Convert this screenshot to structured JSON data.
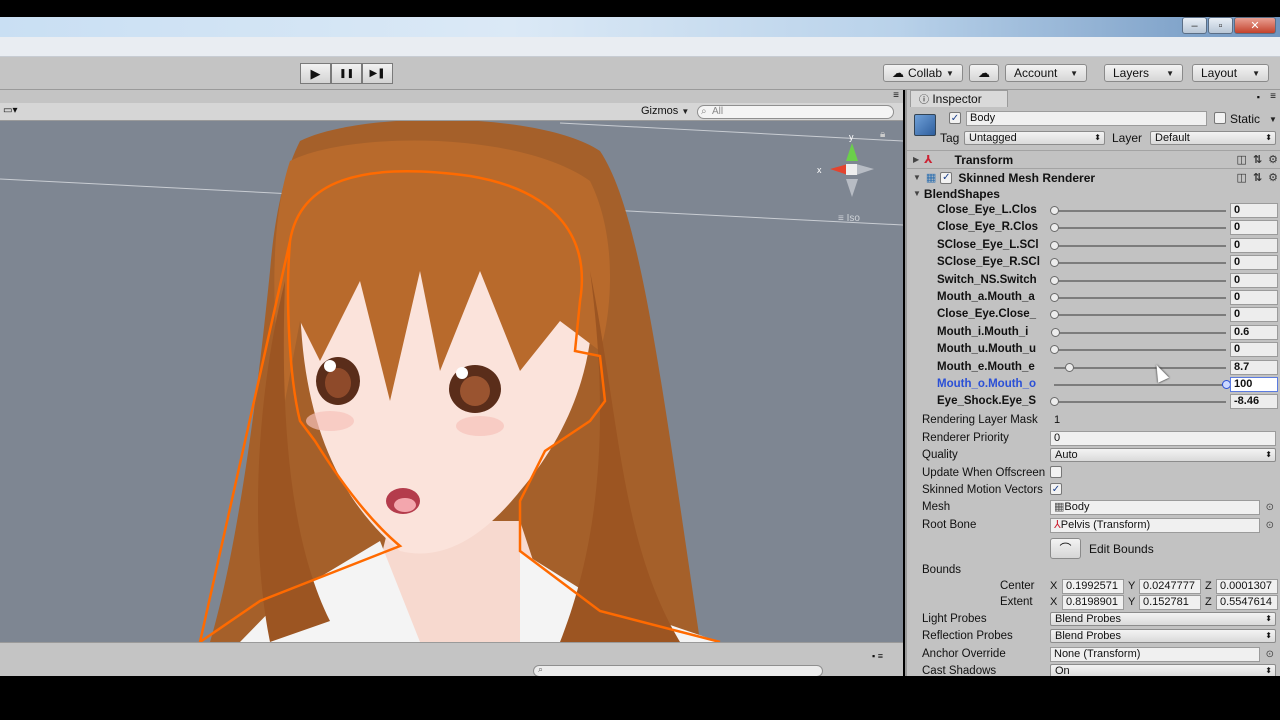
{
  "toolbar": {
    "play_icon": "▶",
    "pause_icon": "❚❚",
    "step_icon": "▶❚",
    "collab": "Collab",
    "account": "Account",
    "layers": "Layers",
    "layout": "Layout"
  },
  "scene": {
    "gizmos": "Gizmos",
    "search_placeholder": "All",
    "axis_y": "y",
    "axis_x": "x",
    "projection": "Iso"
  },
  "inspector": {
    "tab": "Inspector",
    "object_name": "Body",
    "static": "Static",
    "tag_label": "Tag",
    "tag_value": "Untagged",
    "layer_label": "Layer",
    "layer_value": "Default",
    "transform": "Transform",
    "skinned_mesh": "Skinned Mesh Renderer",
    "blendshapes_title": "BlendShapes",
    "blendshapes": [
      {
        "label": "Close_Eye_L.Clos",
        "value": "0",
        "fraction": 0.0
      },
      {
        "label": "Close_Eye_R.Clos",
        "value": "0",
        "fraction": 0.0
      },
      {
        "label": "SClose_Eye_L.SCl",
        "value": "0",
        "fraction": 0.0
      },
      {
        "label": "SClose_Eye_R.SCl",
        "value": "0",
        "fraction": 0.0
      },
      {
        "label": "Switch_NS.Switch",
        "value": "0",
        "fraction": 0.0
      },
      {
        "label": "Mouth_a.Mouth_a",
        "value": "0",
        "fraction": 0.0
      },
      {
        "label": "Close_Eye.Close_",
        "value": "0",
        "fraction": 0.0
      },
      {
        "label": "Mouth_i.Mouth_i",
        "value": "0.6",
        "fraction": 0.006
      },
      {
        "label": "Mouth_u.Mouth_u",
        "value": "0",
        "fraction": 0.0
      },
      {
        "label": "Mouth_e.Mouth_e",
        "value": "8.7",
        "fraction": 0.087
      },
      {
        "label": "Mouth_o.Mouth_o",
        "value": "100",
        "fraction": 1.0
      },
      {
        "label": "Eye_Shock.Eye_S",
        "value": "-8.46",
        "fraction": 0.0
      }
    ],
    "rendering_layer_mask_label": "Rendering Layer Mask",
    "rendering_layer_mask": "1",
    "renderer_priority_label": "Renderer Priority",
    "renderer_priority": "0",
    "quality_label": "Quality",
    "quality": "Auto",
    "update_offscreen_label": "Update When Offscreen",
    "skinned_motion_label": "Skinned Motion Vectors",
    "mesh_label": "Mesh",
    "mesh": "Body",
    "root_bone_label": "Root Bone",
    "root_bone": "Pelvis (Transform)",
    "edit_bounds": "Edit Bounds",
    "bounds_label": "Bounds",
    "center_label": "Center",
    "center": {
      "x": "0.1992571",
      "y": "0.0247777",
      "z": "0.0001307"
    },
    "extent_label": "Extent",
    "extent": {
      "x": "0.8198901",
      "y": "0.152781",
      "z": "0.5547614"
    },
    "light_probes_label": "Light Probes",
    "light_probes": "Blend Probes",
    "reflection_probes_label": "Reflection Probes",
    "reflection_probes": "Blend Probes",
    "anchor_override_label": "Anchor Override",
    "anchor_override": "None (Transform)",
    "cast_shadows_label": "Cast Shadows",
    "cast_shadows": "On"
  },
  "colors": {
    "selection_outline": "#ff6a00",
    "hair": "#b86a2c",
    "scene_bg": "#7e8692",
    "active_blue": "#2a4fd6"
  }
}
